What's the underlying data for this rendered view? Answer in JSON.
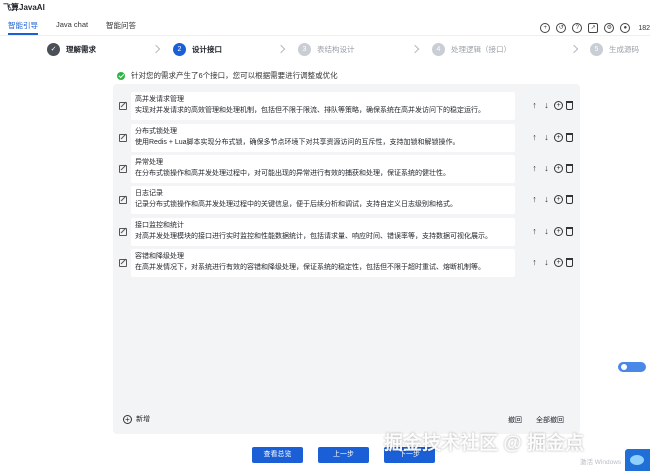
{
  "app": {
    "title": "飞算JavaAI"
  },
  "nav": {
    "tabs": [
      {
        "label": "智能引导",
        "active": true
      },
      {
        "label": "Java chat",
        "active": false
      },
      {
        "label": "智能问答",
        "active": false
      }
    ],
    "icons": [
      "add-icon",
      "history-icon",
      "help-icon",
      "export-icon",
      "settings-icon"
    ],
    "user_count": "182"
  },
  "steps": [
    {
      "num": "✓",
      "label": "理解需求",
      "state": "done"
    },
    {
      "num": "2",
      "label": "设计接口",
      "state": "current"
    },
    {
      "num": "3",
      "label": "表结构设计",
      "state": "pending"
    },
    {
      "num": "4",
      "label": "处理逻辑（接口）",
      "state": "pending"
    },
    {
      "num": "5",
      "label": "生成源码",
      "state": "pending"
    }
  ],
  "notice": "针对您的需求产生了6个接口，您可以根据需要进行调整或优化",
  "interfaces": [
    {
      "title": "高并发请求管理",
      "desc": "实现对并发请求的高效管理和处理机制，包括但不限于限流、排队等策略，确保系统在高并发访问下的稳定运行。"
    },
    {
      "title": "分布式锁处理",
      "desc": "使用Redis + Lua脚本实现分布式锁，确保多节点环境下对共享资源访问的互斥性，支持加锁和解锁操作。"
    },
    {
      "title": "异常处理",
      "desc": "在分布式锁操作和高并发处理过程中，对可能出现的异常进行有效的捕获和处理，保证系统的健壮性。"
    },
    {
      "title": "日志记录",
      "desc": "记录分布式锁操作和高并发处理过程中的关键信息，便于后续分析和调试，支持自定义日志级别和格式。"
    },
    {
      "title": "接口监控和统计",
      "desc": "对高并发处理模块的接口进行实时监控和性能数据统计，包括请求量、响应时间、错误率等，支持数据可视化展示。"
    },
    {
      "title": "容错和降级处理",
      "desc": "在高并发情况下，对系统进行有效的容错和降级处理，保证系统的稳定性，包括但不限于超时重试、熔断机制等。"
    }
  ],
  "panel": {
    "add_label": "新增",
    "undo_label": "撤回",
    "undo_all_label": "全部撤回"
  },
  "buttons": {
    "view_all": "查看总览",
    "prev": "上一步",
    "next": "下一步"
  },
  "watermark": "掘金技术社区 @ 掘金点",
  "os_notice": "激活 Windows",
  "colors": {
    "accent": "#1b5fd6",
    "success": "#2fb344",
    "panel_bg": "#f3f4f6"
  }
}
